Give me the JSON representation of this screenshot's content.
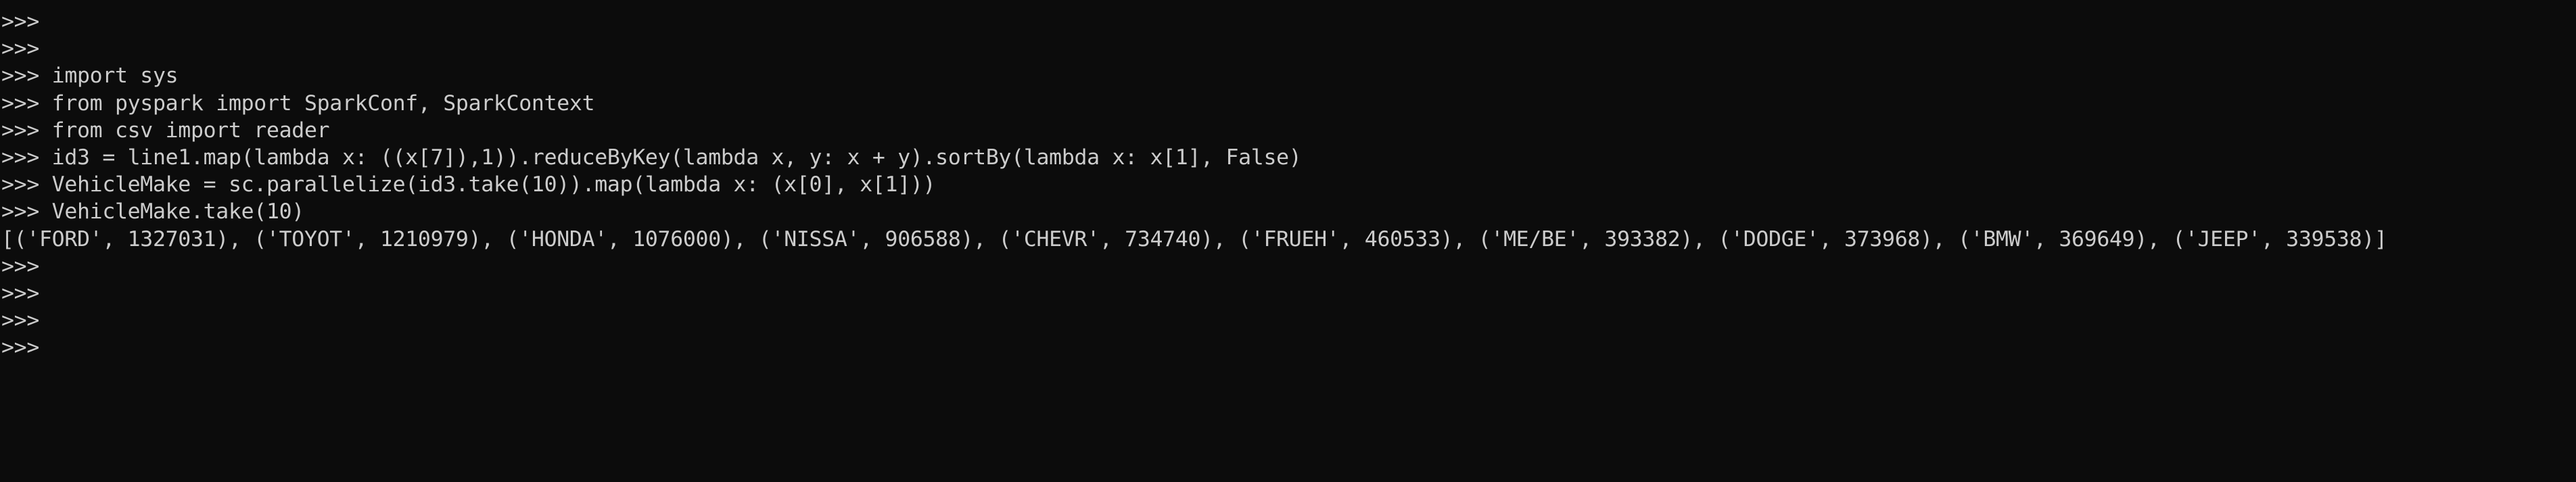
{
  "terminal": {
    "lines": [
      ">>>",
      ">>>",
      ">>> import sys",
      ">>> from pyspark import SparkConf, SparkContext",
      ">>> from csv import reader",
      ">>> id3 = line1.map(lambda x: ((x[7]),1)).reduceByKey(lambda x, y: x + y).sortBy(lambda x: x[1], False)",
      ">>> VehicleMake = sc.parallelize(id3.take(10)).map(lambda x: (x[0], x[1]))",
      ">>> VehicleMake.take(10)",
      "[('FORD', 1327031), ('TOYOT', 1210979), ('HONDA', 1076000), ('NISSA', 906588), ('CHEVR', 734740), ('FRUEH', 460533), ('ME/BE', 393382), ('DODGE', 373968), ('BMW', 369649), ('JEEP', 339538)]",
      ">>>",
      ">>>",
      ">>>",
      ">>>"
    ],
    "colors": {
      "background": "#0c0c0c",
      "foreground": "#cccccc"
    }
  }
}
